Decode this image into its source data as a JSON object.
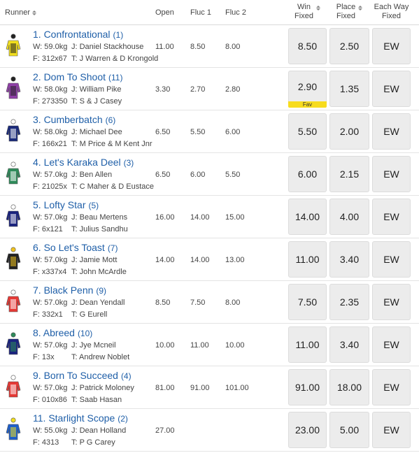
{
  "header": {
    "runner": "Runner",
    "open": "Open",
    "fluc1": "Fluc 1",
    "fluc2": "Fluc 2",
    "win_l1": "Win",
    "win_l2": "Fixed",
    "place_l1": "Place",
    "place_l2": "Fixed",
    "ew_l1": "Each Way",
    "ew_l2": "Fixed"
  },
  "runners": [
    {
      "name": "1. Confrontational",
      "barrier": "(1)",
      "weight": "W: 59.0kg",
      "jockey": "J: Daniel Stackhouse",
      "form": "F: 312x67",
      "trainer": "T: J Warren & D Krongold",
      "open": "11.00",
      "fluc1": "8.50",
      "fluc2": "8.00",
      "win": "8.50",
      "place": "2.50",
      "ew": "EW",
      "silk_colors": [
        "#f1de1e",
        "#222222"
      ]
    },
    {
      "name": "2. Dom To Shoot",
      "barrier": "(11)",
      "weight": "W: 58.0kg",
      "jockey": "J: William Pike",
      "form": "F: 273350",
      "trainer": "T: S & J Casey",
      "open": "3.30",
      "fluc1": "2.70",
      "fluc2": "2.80",
      "win": "2.90",
      "place": "1.35",
      "ew": "EW",
      "fav": "Fav",
      "silk_colors": [
        "#8e3fa6",
        "#222222"
      ]
    },
    {
      "name": "3. Cumberbatch",
      "barrier": "(6)",
      "weight": "W: 58.0kg",
      "jockey": "J: Michael Dee",
      "form": "F: 166x21",
      "trainer": "T: M Price & M Kent Jnr",
      "open": "6.50",
      "fluc1": "5.50",
      "fluc2": "6.00",
      "win": "5.50",
      "place": "2.00",
      "ew": "EW",
      "silk_colors": [
        "#1a2a7a",
        "#ffffff"
      ]
    },
    {
      "name": "4. Let's Karaka Deel",
      "barrier": "(3)",
      "weight": "W: 57.0kg",
      "jockey": "J: Ben Allen",
      "form": "F: 21025x",
      "trainer": "T: C Maher & D Eustace",
      "open": "6.50",
      "fluc1": "6.00",
      "fluc2": "5.50",
      "win": "6.00",
      "place": "2.15",
      "ew": "EW",
      "silk_colors": [
        "#2e8a5a",
        "#ffffff"
      ]
    },
    {
      "name": "5. Lofty Star",
      "barrier": "(5)",
      "weight": "W: 57.0kg",
      "jockey": "J: Beau Mertens",
      "form": "F: 6x121",
      "trainer": "T: Julius Sandhu",
      "open": "16.00",
      "fluc1": "14.00",
      "fluc2": "15.00",
      "win": "14.00",
      "place": "4.00",
      "ew": "EW",
      "silk_colors": [
        "#1a237e",
        "#ffffff"
      ]
    },
    {
      "name": "6. So Let's Toast",
      "barrier": "(7)",
      "weight": "W: 57.0kg",
      "jockey": "J: Jamie Mott",
      "form": "F: x337x4",
      "trainer": "T: John McArdle",
      "open": "14.00",
      "fluc1": "14.00",
      "fluc2": "13.00",
      "win": "11.00",
      "place": "3.40",
      "ew": "EW",
      "silk_colors": [
        "#222222",
        "#f1c21e"
      ]
    },
    {
      "name": "7. Black Penn",
      "barrier": "(9)",
      "weight": "W: 57.0kg",
      "jockey": "J: Dean Yendall",
      "form": "F: 332x1",
      "trainer": "T: G Eurell",
      "open": "8.50",
      "fluc1": "7.50",
      "fluc2": "8.00",
      "win": "7.50",
      "place": "2.35",
      "ew": "EW",
      "silk_colors": [
        "#e53935",
        "#ffffff"
      ]
    },
    {
      "name": "8. Abreed",
      "barrier": "(10)",
      "weight": "W: 57.0kg",
      "jockey": "J: Jye Mcneil",
      "form": "F: 13x",
      "trainer": "T: Andrew Noblet",
      "open": "10.00",
      "fluc1": "11.00",
      "fluc2": "10.00",
      "win": "11.00",
      "place": "3.40",
      "ew": "EW",
      "silk_colors": [
        "#1a237e",
        "#2e8a5a"
      ]
    },
    {
      "name": "9. Born To Succeed",
      "barrier": "(4)",
      "weight": "W: 57.0kg",
      "jockey": "J: Patrick Moloney",
      "form": "F: 010x86",
      "trainer": "T: Saab Hasan",
      "open": "81.00",
      "fluc1": "91.00",
      "fluc2": "101.00",
      "win": "91.00",
      "place": "18.00",
      "ew": "EW",
      "silk_colors": [
        "#e53935",
        "#ffffff"
      ]
    },
    {
      "name": "11. Starlight Scope",
      "barrier": "(2)",
      "weight": "W: 55.0kg",
      "jockey": "J: Dean Holland",
      "form": "F: 4313",
      "trainer": "T: P G Carey",
      "open": "27.00",
      "fluc1": "",
      "fluc2": "",
      "win": "23.00",
      "place": "5.00",
      "ew": "EW",
      "silk_colors": [
        "#1e5fc9",
        "#f1de1e"
      ]
    }
  ]
}
